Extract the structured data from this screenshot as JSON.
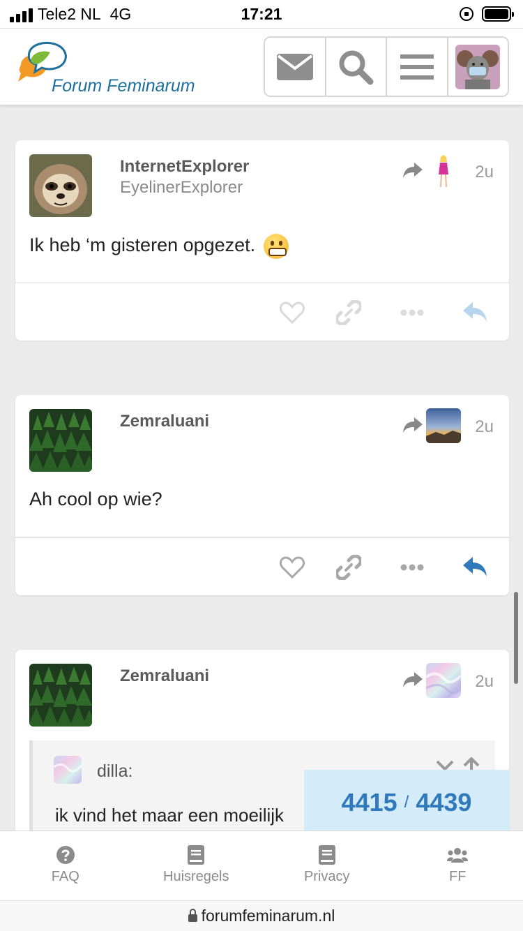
{
  "status_bar": {
    "carrier": "Tele2 NL",
    "network": "4G",
    "time": "17:21"
  },
  "header": {
    "logo_text": "Forum Feminarum",
    "icons": [
      "envelope-icon",
      "search-icon",
      "hamburger-menu-icon",
      "user-avatar"
    ]
  },
  "posts": [
    {
      "username": "InternetExplorer",
      "user_title": "EyelinerExplorer",
      "time": "2u",
      "body": "Ik heb ‘m gisteren opgezet.",
      "emoji": "grimacing-face"
    },
    {
      "username": "Zemraluani",
      "user_title": "",
      "time": "2u",
      "body": "Ah cool op wie?"
    },
    {
      "username": "Zemraluani",
      "user_title": "",
      "time": "2u",
      "quote": {
        "author": "dilla:",
        "text": "ik vind het maar een moeilijk"
      }
    }
  ],
  "timeline": {
    "current": "4415",
    "separator": "/",
    "total": "4439"
  },
  "bottom_nav": [
    {
      "label": "FAQ",
      "icon": "question-circle-icon"
    },
    {
      "label": "Huisregels",
      "icon": "book-icon"
    },
    {
      "label": "Privacy",
      "icon": "book-icon"
    },
    {
      "label": "FF",
      "icon": "users-icon"
    }
  ],
  "url_bar": {
    "url": "forumfeminarum.nl"
  },
  "colors": {
    "accent": "#3079bb",
    "timeline_bg": "#d4ebf9",
    "logo_blue": "#1f6f9e"
  }
}
